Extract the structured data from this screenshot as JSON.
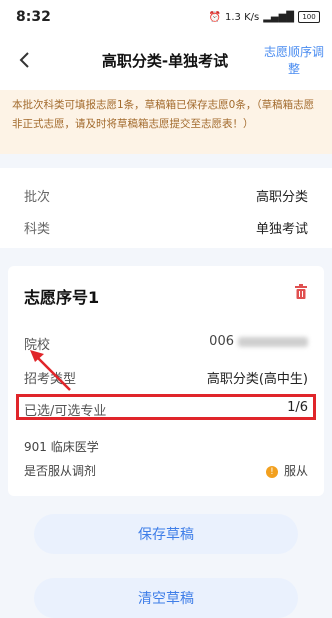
{
  "status": {
    "time": "8:32",
    "speed": "1.3 K/s",
    "battery": "100"
  },
  "nav": {
    "title": "高职分类-单独考试",
    "action": "志愿顺序调整"
  },
  "notice": "本批次科类可填报志愿1条，草稿箱已保存志愿0条，（草稿箱志愿非正式志愿，请及时将草稿箱志愿提交至志愿表！）",
  "info": {
    "batch_label": "批次",
    "batch_value": "高职分类",
    "category_label": "科类",
    "category_value": "单独考试"
  },
  "choice": {
    "title": "志愿序号1",
    "school_label": "院校",
    "school_value": "006",
    "type_label": "招考类型",
    "type_value": "高职分类(高中生)",
    "major_label": "已选/可选专业",
    "major_value": "1/6",
    "major_item": "901 临床医学",
    "adjust_label": "是否服从调剂",
    "adjust_value": "服从"
  },
  "buttons": {
    "save": "保存草稿",
    "clear": "清空草稿"
  }
}
